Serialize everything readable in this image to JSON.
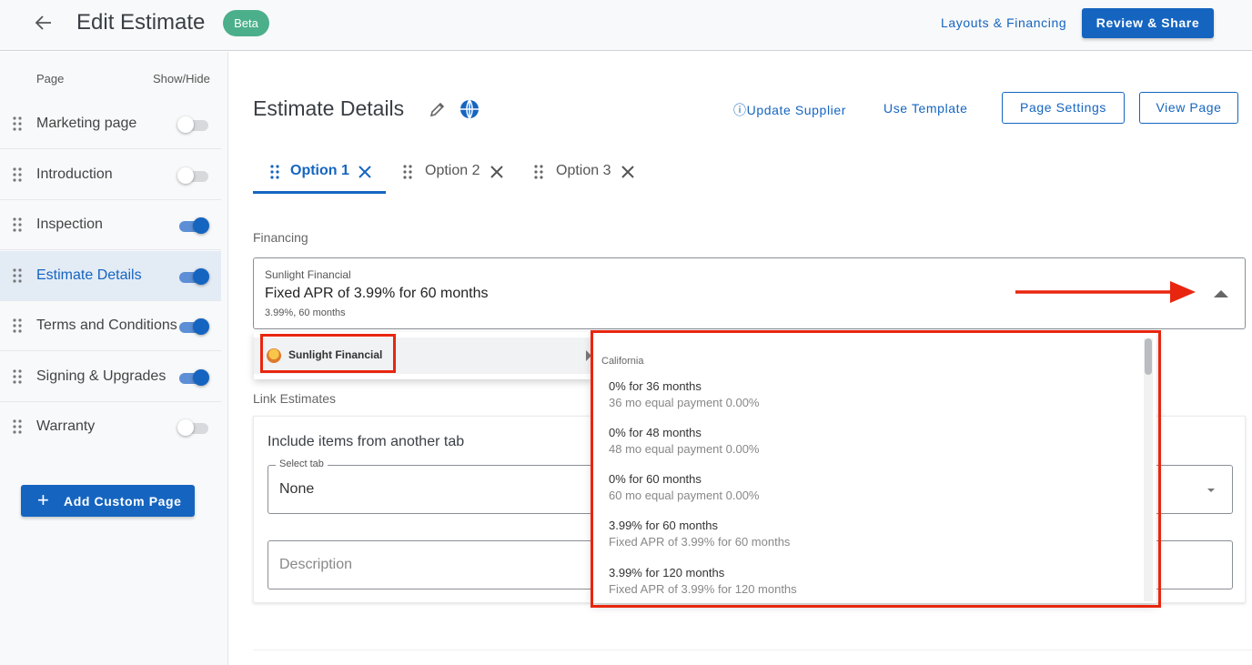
{
  "header": {
    "title": "Edit Estimate",
    "badge": "Beta",
    "layouts_link": "Layouts & Financing",
    "review_button": "Review & Share"
  },
  "sidebar": {
    "page_header": "Page",
    "showhide_header": "Show/Hide",
    "items": [
      {
        "label": "Marketing page",
        "visible": false,
        "active": false
      },
      {
        "label": "Introduction",
        "visible": false,
        "active": false
      },
      {
        "label": "Inspection",
        "visible": true,
        "active": false
      },
      {
        "label": "Estimate Details",
        "visible": true,
        "active": true
      },
      {
        "label": "Terms and Conditions",
        "visible": true,
        "active": false
      },
      {
        "label": "Signing & Upgrades",
        "visible": true,
        "active": false
      },
      {
        "label": "Warranty",
        "visible": false,
        "active": false
      }
    ],
    "add_button": "Add Custom Page"
  },
  "main": {
    "title": "Estimate Details",
    "update_supplier": "Update Supplier",
    "use_template": "Use Template",
    "page_settings": "Page Settings",
    "view_page": "View Page",
    "tabs": [
      {
        "label": "Option 1",
        "active": true
      },
      {
        "label": "Option 2",
        "active": false
      },
      {
        "label": "Option 3",
        "active": false
      }
    ],
    "financing": {
      "label": "Financing",
      "provider_small": "Sunlight Financial",
      "selected": "Fixed APR of 3.99% for 60 months",
      "selected_sub": "3.99%, 60 months"
    },
    "provider_menu": {
      "name": "Sunlight Financial"
    },
    "plans_menu": {
      "group": "California",
      "options": [
        {
          "title": "0% for 36 months",
          "detail": "36 mo equal payment 0.00%"
        },
        {
          "title": "0% for 48 months",
          "detail": "48 mo equal payment 0.00%"
        },
        {
          "title": "0% for 60 months",
          "detail": "60 mo equal payment 0.00%"
        },
        {
          "title": "3.99% for 60 months",
          "detail": "Fixed APR of 3.99% for 60 months"
        },
        {
          "title": "3.99% for 120 months",
          "detail": "Fixed APR of 3.99% for 120 months"
        }
      ]
    },
    "link_estimates": {
      "label": "Link Estimates",
      "card_title": "Include items from another tab",
      "select_legend": "Select tab",
      "select_value": "None",
      "description_placeholder": "Description"
    }
  },
  "colors": {
    "accent": "#1565c0",
    "badge": "#4caf8c",
    "highlight": "#e8260f"
  }
}
